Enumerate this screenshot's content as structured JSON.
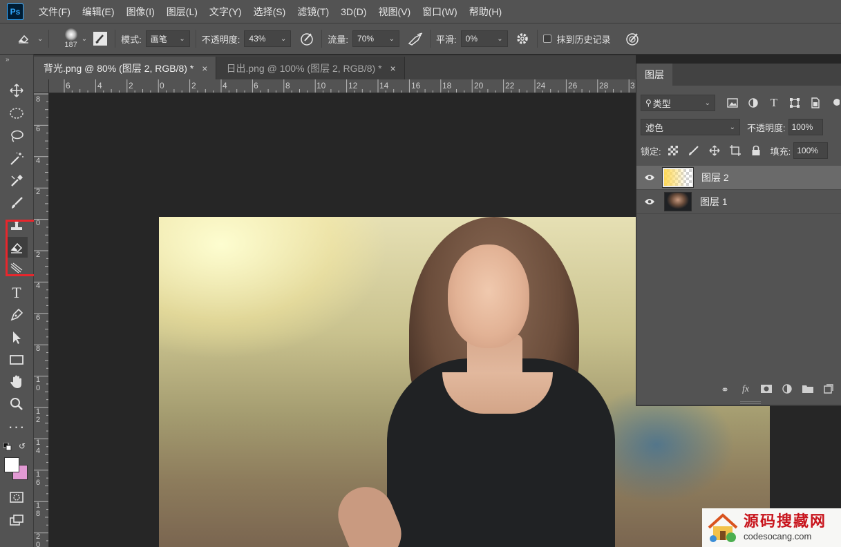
{
  "app": {
    "logo_text": "Ps"
  },
  "menu": [
    "文件(F)",
    "编辑(E)",
    "图像(I)",
    "图层(L)",
    "文字(Y)",
    "选择(S)",
    "滤镜(T)",
    "3D(D)",
    "视图(V)",
    "窗口(W)",
    "帮助(H)"
  ],
  "options": {
    "brush_size": "187",
    "mode_label": "模式:",
    "mode_value": "画笔",
    "opacity_label": "不透明度:",
    "opacity_value": "43%",
    "flow_label": "流量:",
    "flow_value": "70%",
    "smooth_label": "平滑:",
    "smooth_value": "0%",
    "history_label": "抹到历史记录"
  },
  "tabs": [
    {
      "label": "背光.png @ 80% (图层 2, RGB/8) *",
      "active": true
    },
    {
      "label": "日出.png @ 100% (图层 2, RGB/8) *",
      "active": false
    }
  ],
  "ruler_h": [
    "6",
    "4",
    "2",
    "0",
    "2",
    "4",
    "6",
    "8",
    "10",
    "12",
    "14",
    "16",
    "18",
    "20",
    "22",
    "24",
    "26",
    "28",
    "3"
  ],
  "ruler_v": [
    "8",
    "6",
    "4",
    "2",
    "0",
    "2",
    "4",
    "6",
    "8",
    "1 0",
    "1 2",
    "1 4",
    "1 6",
    "1 8",
    "2 0"
  ],
  "layers_panel": {
    "tab_label": "图层",
    "filter_kind": "类型",
    "blend_mode": "滤色",
    "opacity_label": "不透明度:",
    "opacity_value": "100%",
    "lock_label": "锁定:",
    "fill_label": "填充:",
    "fill_value": "100%",
    "layers": [
      {
        "name": "图层 2",
        "selected": true,
        "visible": true
      },
      {
        "name": "图层 1",
        "selected": false,
        "visible": true
      }
    ],
    "footer_fx": "fx"
  },
  "watermark": {
    "cn": "源码搜藏网",
    "en": "codesocang.com"
  },
  "colors": {
    "foreground": "#ffffff",
    "background": "#e29ad4",
    "highlight": "#e8262c"
  }
}
